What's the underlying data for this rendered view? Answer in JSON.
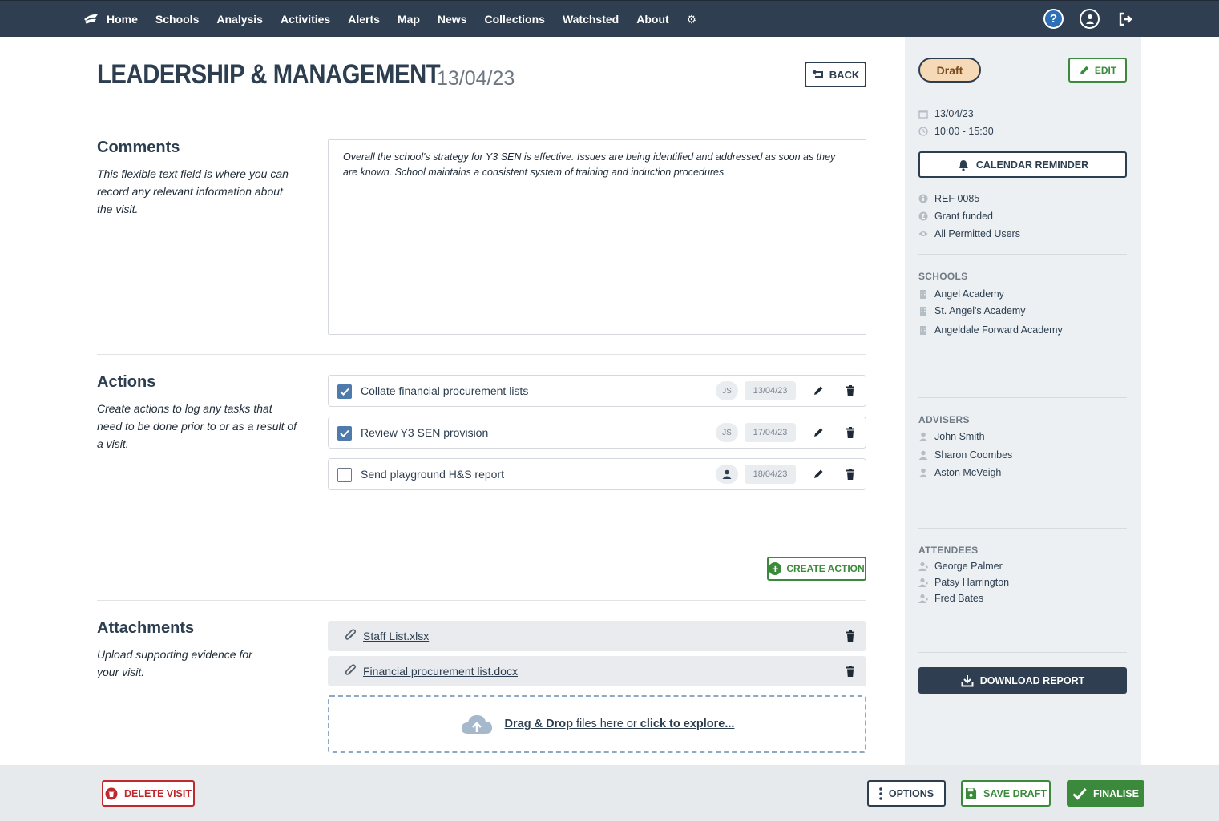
{
  "nav": {
    "items": [
      "Home",
      "Schools",
      "Analysis",
      "Activities",
      "Alerts",
      "Map",
      "News",
      "Collections",
      "Watchsted",
      "About"
    ]
  },
  "header": {
    "title": "LEADERSHIP & MANAGEMENT",
    "date": "13/04/23",
    "back_label": "BACK"
  },
  "comments": {
    "title": "Comments",
    "description": "This flexible text field is where you can record any relevant information about the visit.",
    "text": "Overall the school's strategy for Y3 SEN is effective. Issues are being identified and addressed as soon as they are known. School maintains a consistent system of training and induction procedures."
  },
  "actions": {
    "title": "Actions",
    "description": "Create actions to log any tasks that need to be done prior to or as a result of a visit.",
    "items": [
      {
        "label": "Collate financial procurement lists",
        "checked": true,
        "assignee": "JS",
        "due": "13/04/23"
      },
      {
        "label": "Review Y3 SEN provision",
        "checked": true,
        "assignee": "JS",
        "due": "17/04/23"
      },
      {
        "label": "Send playground H&S report",
        "checked": false,
        "assignee": "",
        "due": "18/04/23"
      }
    ],
    "create_label": "CREATE ACTION"
  },
  "attachments": {
    "title": "Attachments",
    "description": "Upload supporting evidence for your visit.",
    "files": [
      "Staff List.xlsx",
      "Financial procurement list.docx"
    ],
    "drop_bold1": "Drag & Drop",
    "drop_mid": " files here or ",
    "drop_bold2": "click to explore..."
  },
  "sidebar": {
    "status": "Draft",
    "edit_label": "EDIT",
    "date": "13/04/23",
    "time": "10:00 - 15:30",
    "calendar_label": "CALENDAR REMINDER",
    "ref": "REF 0085",
    "funding": "Grant funded",
    "visibility": "All Permitted Users",
    "schools_heading": "SCHOOLS",
    "schools": [
      "Angel Academy",
      "St. Angel's Academy",
      "Angeldale Forward Academy"
    ],
    "advisers_heading": "ADVISERS",
    "advisers": [
      "John Smith",
      "Sharon Coombes",
      "Aston McVeigh"
    ],
    "attendees_heading": "ATTENDEES",
    "attendees": [
      "George Palmer",
      "Patsy Harrington",
      "Fred Bates"
    ],
    "download_label": "DOWNLOAD REPORT"
  },
  "footer": {
    "delete_label": "DELETE VISIT",
    "options_label": "OPTIONS",
    "save_label": "SAVE DRAFT",
    "finalise_label": "FINALISE"
  },
  "colors": {
    "nav_bg": "#2f3e50",
    "accent_green": "#3b8a3b",
    "danger_red": "#c0282d",
    "draft_badge": "#f6d9b7",
    "checkbox_blue": "#4e7bab"
  }
}
